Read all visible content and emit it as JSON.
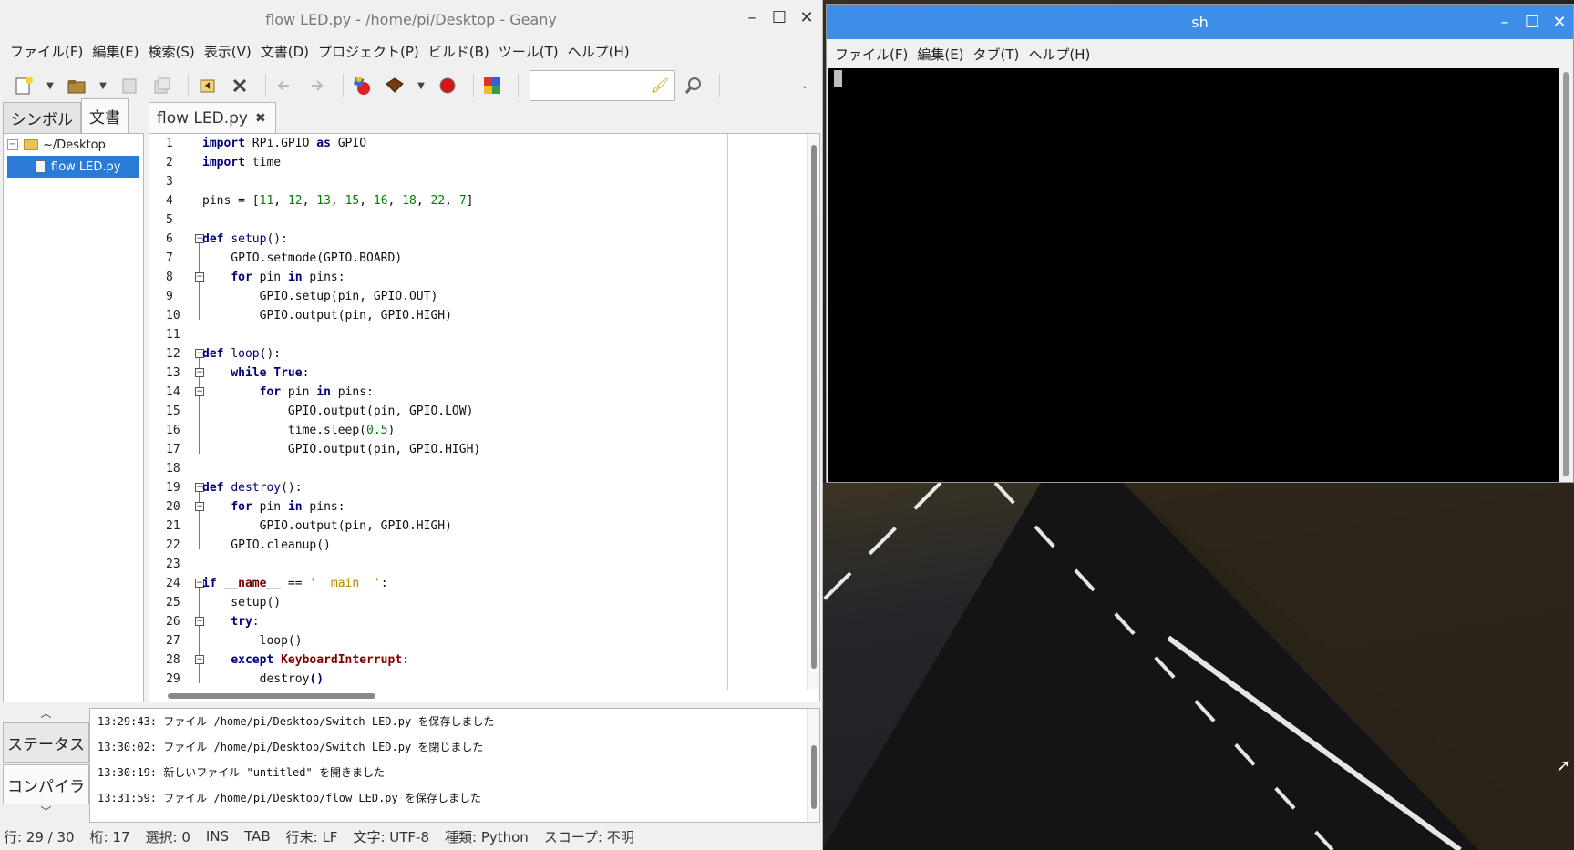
{
  "geany": {
    "title": "flow LED.py - /home/pi/Desktop - Geany",
    "menu": [
      "ファイル(F)",
      "編集(E)",
      "検索(S)",
      "表示(V)",
      "文書(D)",
      "プロジェクト(P)",
      "ビルド(B)",
      "ツール(T)",
      "ヘルプ(H)"
    ],
    "sidebar_tabs": [
      "シンボル",
      "文書"
    ],
    "tree": {
      "folder": "~/Desktop",
      "file": "flow LED.py"
    },
    "editor_tab": "flow LED.py",
    "line_numbers": [
      "1",
      "2",
      "3",
      "4",
      "5",
      "6",
      "7",
      "8",
      "9",
      "10",
      "11",
      "12",
      "13",
      "14",
      "15",
      "16",
      "17",
      "18",
      "19",
      "20",
      "21",
      "22",
      "23",
      "24",
      "25",
      "26",
      "27",
      "28",
      "29"
    ],
    "message_tabs": [
      "ステータス",
      "コンパイラ"
    ],
    "messages": [
      "13:29:43: ファイル /home/pi/Desktop/Switch LED.py を保存しました",
      "13:30:02: ファイル /home/pi/Desktop/Switch LED.py を閉じました",
      "13:30:19: 新しいファイル \"untitled\" を開きました",
      "13:31:59: ファイル /home/pi/Desktop/flow LED.py を保存しました"
    ],
    "status": {
      "line": "行: 29 / 30",
      "col": "桁: 17",
      "sel": "選択: 0",
      "ins": "INS",
      "tab": "TAB",
      "eol": "行末: LF",
      "enc": "文字: UTF-8",
      "type": "種類: Python",
      "scope": "スコープ: 不明"
    }
  },
  "terminal": {
    "title": "sh",
    "menu": [
      "ファイル(F)",
      "編集(E)",
      "タブ(T)",
      "ヘルプ(H)"
    ]
  },
  "colors": {
    "terminal_titlebar": "#3d8ee8",
    "selection": "#2a7bd6",
    "keyword": "#00007f",
    "number": "#007f00",
    "string": "#b38600"
  },
  "icons": [
    "new-file-icon",
    "open-file-icon",
    "save-icon",
    "save-all-icon",
    "revert-icon",
    "close-file-icon",
    "back-icon",
    "forward-icon",
    "compile-icon",
    "build-icon",
    "run-icon",
    "color-chooser-icon",
    "clear-search-icon",
    "find-icon"
  ]
}
